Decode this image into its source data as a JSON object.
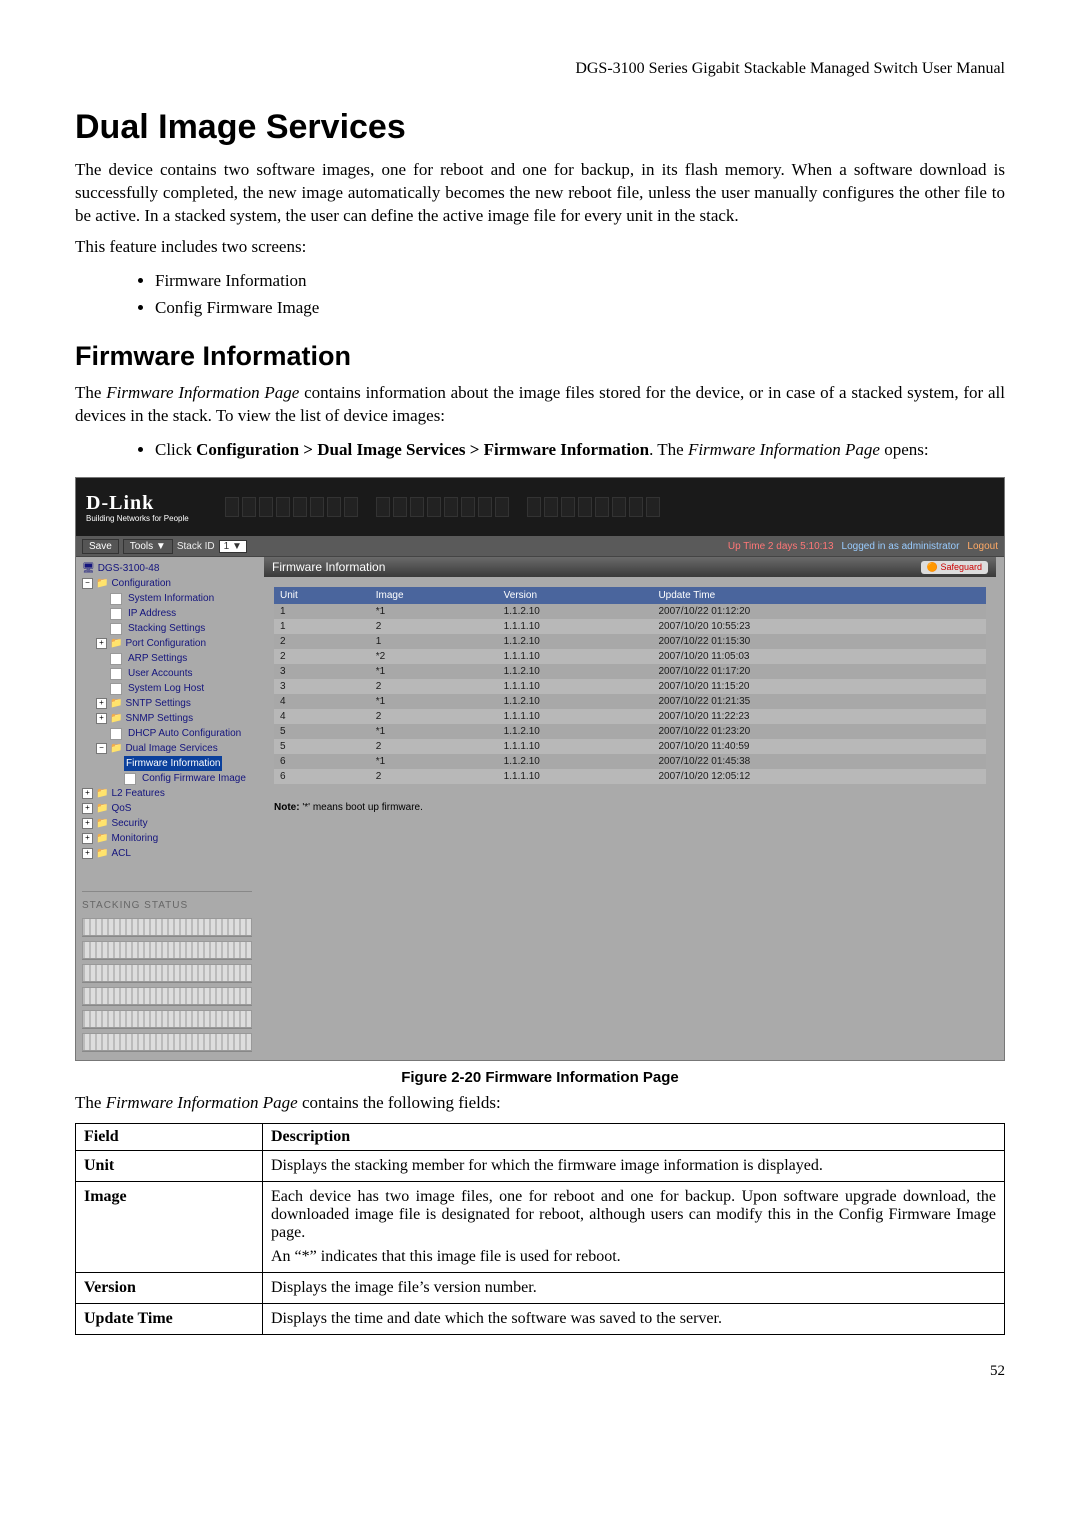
{
  "header": {
    "manual_title": "DGS-3100 Series Gigabit Stackable Managed Switch User Manual"
  },
  "section": {
    "h1": "Dual Image Services",
    "p1": "The device contains two software images, one for reboot and one for backup, in its flash memory. When a software download is successfully completed, the new image automatically becomes the new reboot file, unless the user manually configures the other file to be active. In a stacked system, the user can define the active image file for every unit in the stack.",
    "p2": "This feature includes two screens:",
    "b1": "Firmware Information",
    "b2": "Config Firmware Image",
    "h2": "Firmware Information",
    "p3a": "The ",
    "p3b": "Firmware Information Page",
    "p3c": " contains information about the image files stored for the device, or in case of a stacked system, for all devices in the stack. To view the list of device images:",
    "nav_pre": "Click ",
    "nav_bold": "Configuration > Dual Image Services > Firmware Information",
    "nav_mid": ". The ",
    "nav_ital": "Firmware Information Page",
    "nav_end": " opens:"
  },
  "screenshot": {
    "logo": "D-Link",
    "logo_sub": "Building Networks for People",
    "tb": {
      "save": "Save",
      "tools": "Tools",
      "stackid_lbl": "Stack ID",
      "stackid_val": "1",
      "uptime": "Up Time 2 days 5:10:13",
      "logged": "Logged in as administrator",
      "logout": "Logout"
    },
    "tree": {
      "root": "DGS-3100-48",
      "conf": "Configuration",
      "sysinfo": "System Information",
      "ip": "IP Address",
      "stk": "Stacking Settings",
      "port": "Port Configuration",
      "arp": "ARP Settings",
      "user": "User Accounts",
      "slog": "System Log Host",
      "sntp": "SNTP Settings",
      "snmp": "SNMP Settings",
      "dhcp": "DHCP Auto Configuration",
      "dual": "Dual Image Services",
      "fw": "Firmware Information",
      "cfw": "Config Firmware Image",
      "l2": "L2 Features",
      "qos": "QoS",
      "sec": "Security",
      "mon": "Monitoring",
      "acl": "ACL",
      "stack_status": "STACKING STATUS"
    },
    "panel": {
      "title": "Firmware Information",
      "badge": "Safeguard"
    },
    "cols": {
      "c1": "Unit",
      "c2": "Image",
      "c3": "Version",
      "c4": "Update Time"
    },
    "rows": [
      {
        "u": "1",
        "i": "*1",
        "v": "1.1.2.10",
        "t": "2007/10/22 01:12:20"
      },
      {
        "u": "1",
        "i": "2",
        "v": "1.1.1.10",
        "t": "2007/10/20 10:55:23"
      },
      {
        "u": "2",
        "i": "1",
        "v": "1.1.2.10",
        "t": "2007/10/22 01:15:30"
      },
      {
        "u": "2",
        "i": "*2",
        "v": "1.1.1.10",
        "t": "2007/10/20 11:05:03"
      },
      {
        "u": "3",
        "i": "*1",
        "v": "1.1.2.10",
        "t": "2007/10/22 01:17:20"
      },
      {
        "u": "3",
        "i": "2",
        "v": "1.1.1.10",
        "t": "2007/10/20 11:15:20"
      },
      {
        "u": "4",
        "i": "*1",
        "v": "1.1.2.10",
        "t": "2007/10/22 01:21:35"
      },
      {
        "u": "4",
        "i": "2",
        "v": "1.1.1.10",
        "t": "2007/10/20 11:22:23"
      },
      {
        "u": "5",
        "i": "*1",
        "v": "1.1.2.10",
        "t": "2007/10/22 01:23:20"
      },
      {
        "u": "5",
        "i": "2",
        "v": "1.1.1.10",
        "t": "2007/10/20 11:40:59"
      },
      {
        "u": "6",
        "i": "*1",
        "v": "1.1.2.10",
        "t": "2007/10/22 01:45:38"
      },
      {
        "u": "6",
        "i": "2",
        "v": "1.1.1.10",
        "t": "2007/10/20 12:05:12"
      }
    ],
    "note_b": "Note:",
    "note": " '*' means boot up firmware."
  },
  "caption": "Figure 2-20 Firmware Information Page",
  "after_shot_a": "The ",
  "after_shot_b": "Firmware Information Page",
  "after_shot_c": " contains the following fields:",
  "fields": {
    "h1": "Field",
    "h2": "Description",
    "r1f": "Unit",
    "r1d": "Displays the stacking member for which the firmware image information is displayed.",
    "r2f": "Image",
    "r2d1": "Each device has two image files, one for reboot and one for backup. Upon software upgrade download, the downloaded image file is designated for reboot, although users can modify this in the Config Firmware Image page.",
    "r2d2": "An “*” indicates that this image file is used for reboot.",
    "r3f": "Version",
    "r3d": "Displays the image file’s version number.",
    "r4f": "Update Time",
    "r4d": "Displays the time and date which the software was saved to the server."
  },
  "page_num": "52"
}
